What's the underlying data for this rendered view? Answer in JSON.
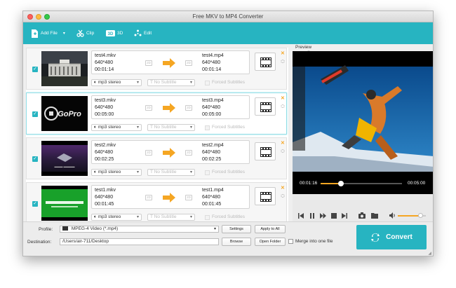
{
  "window": {
    "title": "Free MKV to MP4 Converter"
  },
  "toolbar": {
    "add_file": "Add File",
    "clip": "Clip",
    "three_d": "3D",
    "edit": "Edit"
  },
  "files": [
    {
      "src_name": "test4.mkv",
      "src_res": "640*480",
      "src_dur": "00:01:14",
      "dst_name": "test4.mp4",
      "dst_res": "640*480",
      "dst_dur": "00:01:14",
      "audio": "mp3 stereo",
      "subtitle": "No Subtitle",
      "forced": "Forced Subtitles",
      "checked": true,
      "selected": false,
      "tag": "2D"
    },
    {
      "src_name": "test3.mkv",
      "src_res": "640*480",
      "src_dur": "00:05:00",
      "dst_name": "test3.mp4",
      "dst_res": "640*480",
      "dst_dur": "00:05:00",
      "audio": "mp3 stereo",
      "subtitle": "No Subtitle",
      "forced": "Forced Subtitles",
      "checked": true,
      "selected": true,
      "tag": "2D"
    },
    {
      "src_name": "test2.mkv",
      "src_res": "640*480",
      "src_dur": "00:02:25",
      "dst_name": "test2.mp4",
      "dst_res": "640*480",
      "dst_dur": "00:02:25",
      "audio": "mp3 stereo",
      "subtitle": "No Subtitle",
      "forced": "Forced Subtitles",
      "checked": true,
      "selected": false,
      "tag": "2D"
    },
    {
      "src_name": "test1.mkv",
      "src_res": "640*480",
      "src_dur": "00:01:45",
      "dst_name": "test1.mp4",
      "dst_res": "640*480",
      "dst_dur": "00:01:45",
      "audio": "mp3 stereo",
      "subtitle": "No Subtitle",
      "forced": "Forced Subtitles",
      "checked": true,
      "selected": false,
      "tag": "2D"
    }
  ],
  "preview": {
    "label": "Preview",
    "current_time": "00:01:16",
    "total_time": "00:05:00",
    "progress": 0.25,
    "volume": 0.8
  },
  "bottom": {
    "profile_label": "Profile:",
    "profile_value": "MPEG-4 Video (*.mp4)",
    "settings": "Settings",
    "apply_all": "Apply to All",
    "destination_label": "Destination:",
    "destination_value": "/Users/air-711/Desktop",
    "browse": "Browse",
    "open_folder": "Open Folder",
    "merge": "Merge into one file",
    "convert": "Convert"
  },
  "colors": {
    "accent": "#27b4c1",
    "arrow": "#f5a623"
  }
}
